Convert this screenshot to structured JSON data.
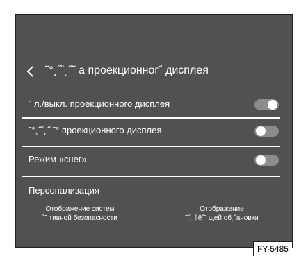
{
  "screen": {
    "back_icon": "chevron-left-icon",
    "title": "˜°¸˝˚˛˝˜ а проекционног˘ дисплея",
    "rows": [
      {
        "label": "˘ л./выкл. проекционного дисплея",
        "toggle_state": "on"
      },
      {
        "label": "˜°¸˝˚˛˝ ˜° проекционного дисплея",
        "toggle_state": "off"
      },
      {
        "label": "Режим «снег»",
        "toggle_state": "off"
      }
    ],
    "personalization": {
      "title": "Персонализация",
      "items": [
        {
          "line1": "Отображение систем",
          "line2": "˚˜ тивной безопасности"
        },
        {
          "line1": "Отображение",
          "line2": "˜˝˛ †ê˚˜ щей об˛˝ановки"
        }
      ]
    }
  },
  "figure_code": "FY-5485",
  "colors": {
    "background": "#515151",
    "text": "#ffffff",
    "toggle_track": "#8c8c8c",
    "toggle_knob": "#ffffff"
  }
}
